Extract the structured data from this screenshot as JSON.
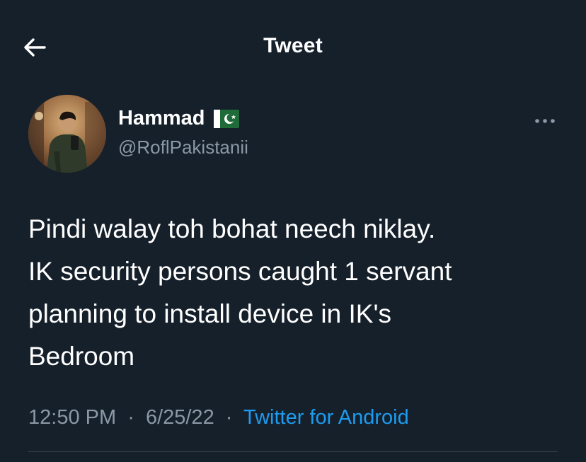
{
  "header": {
    "title": "Tweet",
    "back_icon": "arrow-left-icon"
  },
  "author": {
    "name": "Hammad",
    "handle": "@RoflPakistanii",
    "flag_icon": "pakistan-flag-icon"
  },
  "tweet": {
    "text": "Pindi walay toh bohat neech niklay.\nIK security persons caught 1 servant\nplanning to install device in IK's\nBedroom",
    "time": "12:50 PM",
    "date": "6/25/22",
    "separator": "·",
    "source": "Twitter for Android"
  },
  "colors": {
    "background": "#15202b",
    "primary_text": "#ffffff",
    "secondary_text": "#8b98a5",
    "accent": "#1d9bf0",
    "divider": "#38444d"
  }
}
